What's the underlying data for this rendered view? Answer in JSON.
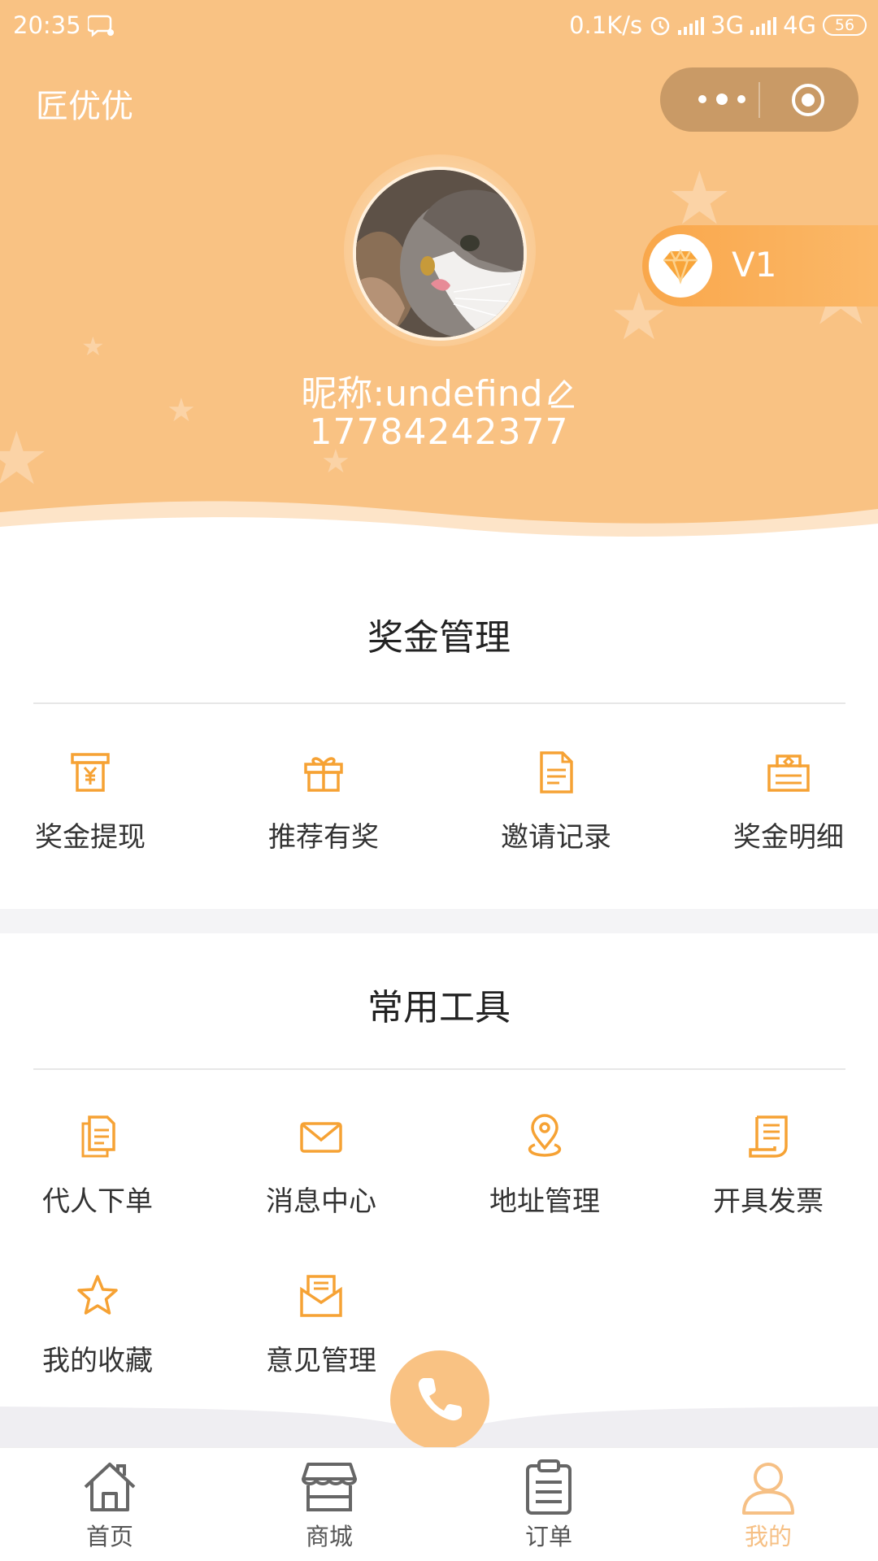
{
  "status_bar": {
    "time": "20:35",
    "network_speed": "0.1K/s",
    "net1": "3G",
    "net2": "4G",
    "battery": "56"
  },
  "header": {
    "app_title": "匠优优",
    "level": "V1",
    "nickname": "昵称:undefind",
    "phone": "17784242377"
  },
  "bonus": {
    "title": "奖金管理",
    "items": [
      {
        "label": "奖金提现",
        "icon": "cash-withdraw-icon"
      },
      {
        "label": "推荐有奖",
        "icon": "gift-icon"
      },
      {
        "label": "邀请记录",
        "icon": "document-icon"
      },
      {
        "label": "奖金明细",
        "icon": "bonus-detail-icon"
      }
    ]
  },
  "tools": {
    "title": "常用工具",
    "items": [
      {
        "label": "代人下单",
        "icon": "order-copy-icon"
      },
      {
        "label": "消息中心",
        "icon": "mail-icon"
      },
      {
        "label": "地址管理",
        "icon": "location-pin-icon"
      },
      {
        "label": "开具发票",
        "icon": "invoice-icon"
      },
      {
        "label": "我的收藏",
        "icon": "star-icon"
      },
      {
        "label": "意见管理",
        "icon": "feedback-envelope-icon"
      }
    ]
  },
  "tabbar": {
    "items": [
      {
        "label": "首页",
        "icon": "home-icon",
        "active": false
      },
      {
        "label": "商城",
        "icon": "shop-icon",
        "active": false
      },
      {
        "label": "订单",
        "icon": "clipboard-icon",
        "active": false
      },
      {
        "label": "我的",
        "icon": "user-icon",
        "active": true
      }
    ]
  },
  "colors": {
    "brand": "#f9c283",
    "accent": "#f7a536",
    "icon_orange": "#f6a234",
    "tab_active": "#f6c085",
    "tab_inactive": "#666666"
  }
}
